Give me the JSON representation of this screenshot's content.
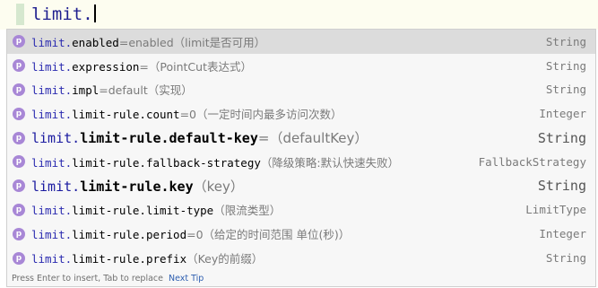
{
  "editor": {
    "code": "limit."
  },
  "popup": {
    "items": [
      {
        "prefix": "limit.",
        "suffix": "enabled",
        "tail": "=enabled（limit是否可用）",
        "type": "String"
      },
      {
        "prefix": "limit.",
        "suffix": "expression",
        "tail": "=（PointCut表达式）",
        "type": "String"
      },
      {
        "prefix": "limit.",
        "suffix": "impl",
        "tail": "=default（实现）",
        "type": "String"
      },
      {
        "prefix": "limit.",
        "suffix": "limit-rule.count",
        "tail": "=0（一定时间内最多访问次数）",
        "type": "Integer"
      },
      {
        "prefix": "limit.",
        "suffix": "limit-rule.default-key",
        "tail": "=（defaultKey）",
        "type": "String"
      },
      {
        "prefix": "limit.",
        "suffix": "limit-rule.fallback-strategy",
        "tail": "（降级策略:默认快速失败）",
        "type": "FallbackStrategy"
      },
      {
        "prefix": "limit.",
        "suffix": "limit-rule.key",
        "tail": "（key）",
        "type": "String"
      },
      {
        "prefix": "limit.",
        "suffix": "limit-rule.limit-type",
        "tail": "（限流类型）",
        "type": "LimitType"
      },
      {
        "prefix": "limit.",
        "suffix": "limit-rule.period",
        "tail": "=0（给定的时间范围 单位(秒)）",
        "type": "Integer"
      },
      {
        "prefix": "limit.",
        "suffix": "limit-rule.prefix",
        "tail": "（Key的前缀）",
        "type": "String"
      }
    ],
    "icon_letter": "p",
    "footer_hint": "Press Enter to insert, Tab to replace",
    "footer_link": "Next Tip"
  },
  "colors": {
    "icon_bg": "#a887d6",
    "selected_row": "#dcdcdc",
    "link": "#2f5fb0"
  }
}
